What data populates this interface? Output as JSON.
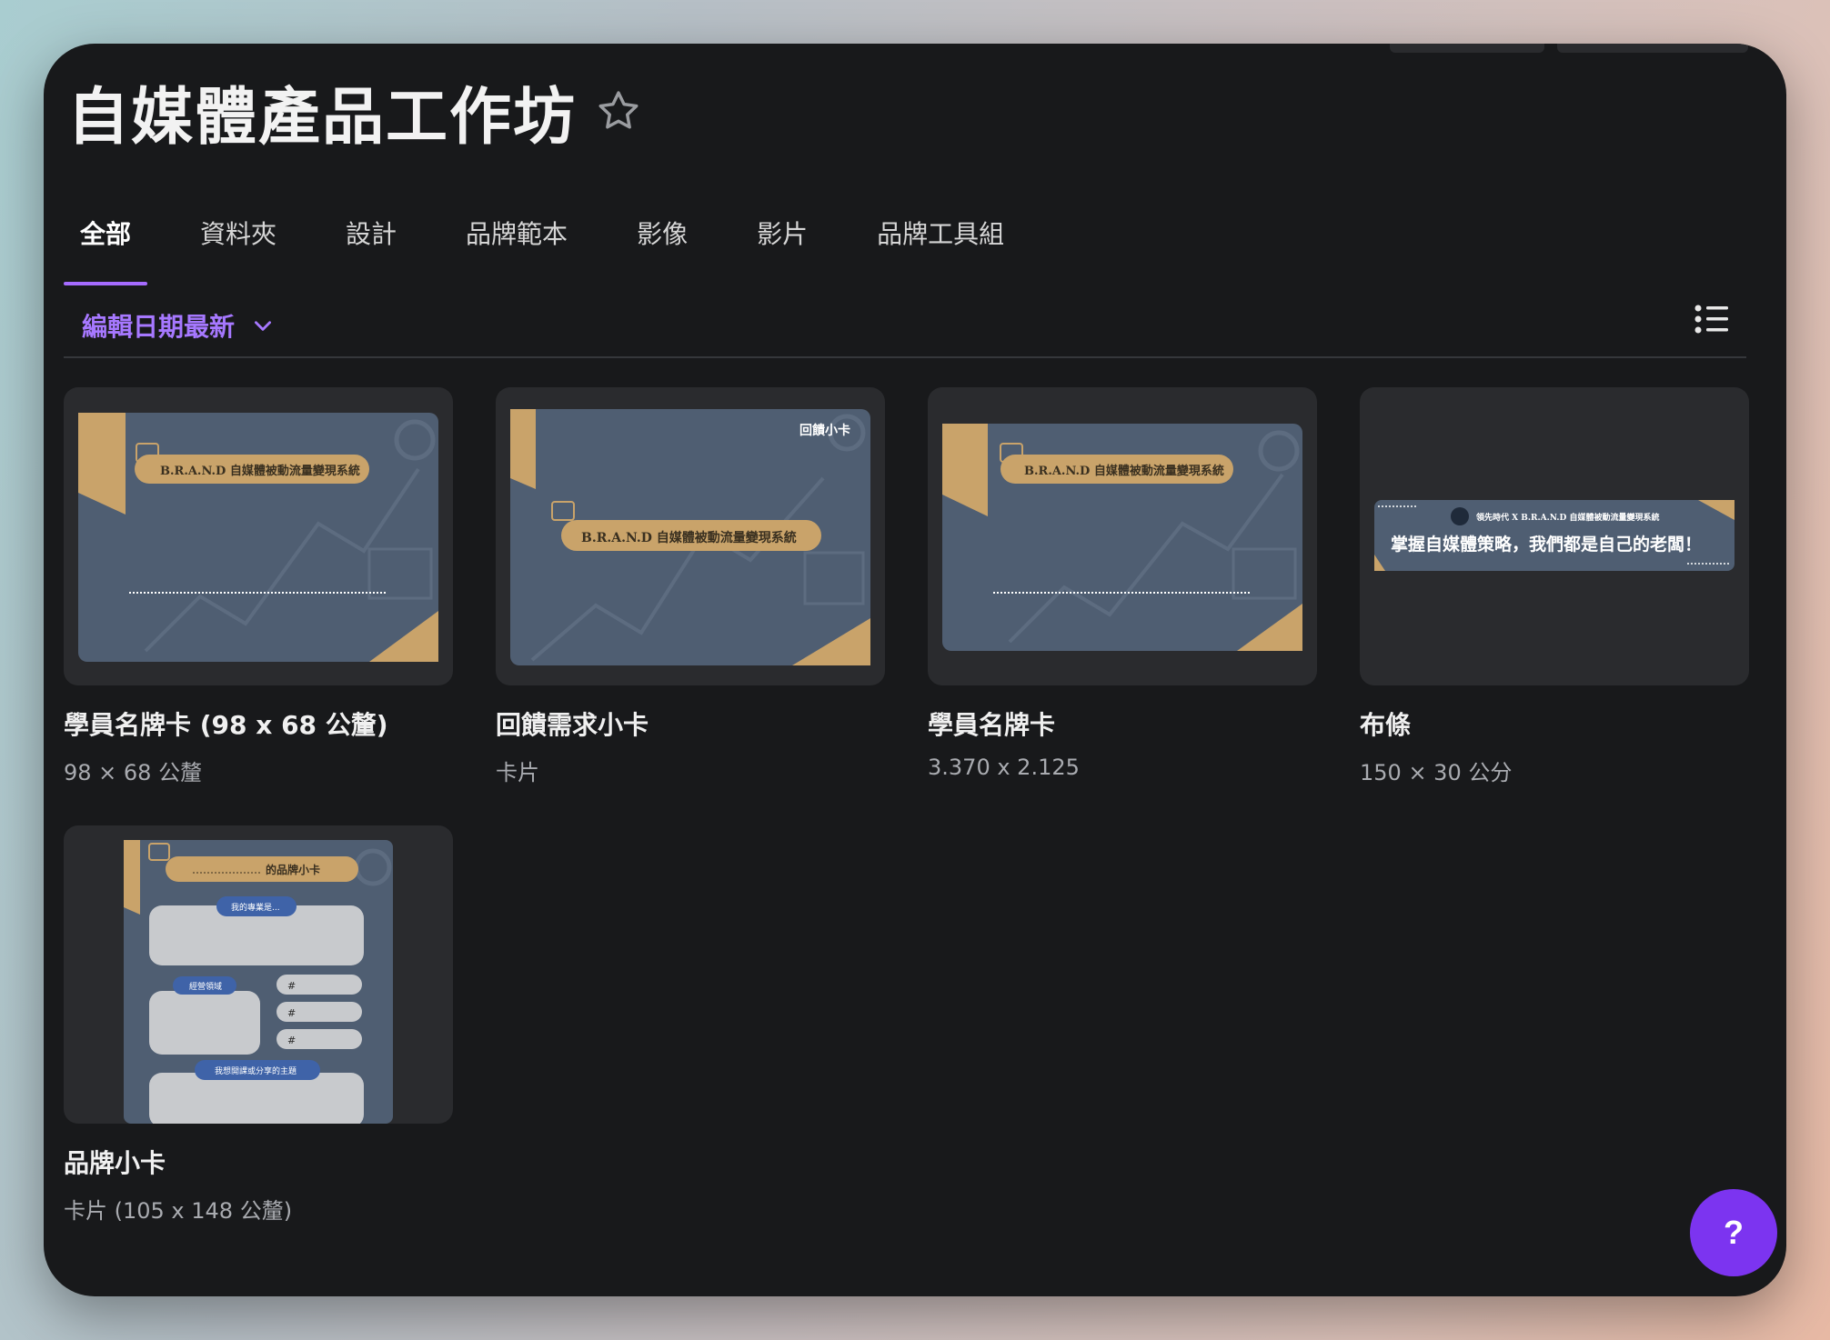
{
  "header": {
    "title": "自媒體產品工作坊"
  },
  "tabs": [
    {
      "label": "全部",
      "active": true
    },
    {
      "label": "資料夾"
    },
    {
      "label": "設計"
    },
    {
      "label": "品牌範本"
    },
    {
      "label": "影像"
    },
    {
      "label": "影片"
    },
    {
      "label": "品牌工具組"
    }
  ],
  "sort": {
    "label": "編輯日期最新"
  },
  "cards": [
    {
      "title": "學員名牌卡 (98 x 68 公釐)",
      "subtitle": "98 × 68 公釐",
      "thumb": {
        "banner": "B.R.A.N.D 自媒體被動流量變現系統"
      }
    },
    {
      "title": "回饋需求小卡",
      "subtitle": "卡片",
      "thumb": {
        "corner": "回饋小卡",
        "banner": "B.R.A.N.D 自媒體被動流量變現系統"
      }
    },
    {
      "title": "學員名牌卡",
      "subtitle": "3.370 x 2.125",
      "thumb": {
        "banner": "B.R.A.N.D 自媒體被動流量變現系統"
      }
    },
    {
      "title": "布條",
      "subtitle": "150 × 30 公分",
      "thumb": {
        "top": "領先時代 X B.R.A.N.D 自媒體被動流量變現系統",
        "main": "掌握自媒體策略，我們都是自己的老闆！"
      }
    },
    {
      "title": "品牌小卡",
      "subtitle": "卡片 (105 x 148 公釐)",
      "thumb": {
        "banner": "的品牌小卡",
        "pill1": "我的專業是...",
        "pill2": "經營領域",
        "hash": "#",
        "pill3": "我想開課或分享的主題"
      }
    }
  ],
  "help": {
    "label": "?"
  },
  "colors": {
    "accent": "#a56bff",
    "help": "#7c34f0",
    "slate": "#4f5e72",
    "gold": "#c9a36a"
  }
}
